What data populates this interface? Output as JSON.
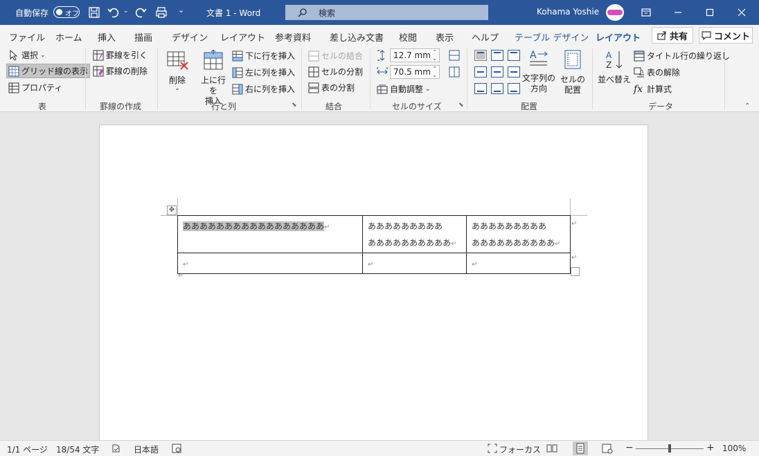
{
  "titlebar": {
    "autosave_label": "自動保存",
    "autosave_state": "オフ",
    "document_title": "文書 1  -  Word",
    "search_placeholder": "検索",
    "user_name": "Kohama Yoshie"
  },
  "tabs": [
    {
      "label": "ファイル"
    },
    {
      "label": "ホーム"
    },
    {
      "label": "挿入"
    },
    {
      "label": "描画"
    },
    {
      "label": "デザイン"
    },
    {
      "label": "レイアウト"
    },
    {
      "label": "参考資料"
    },
    {
      "label": "差し込み文書"
    },
    {
      "label": "校閲"
    },
    {
      "label": "表示"
    },
    {
      "label": "ヘルプ"
    },
    {
      "label": "テーブル デザイン"
    },
    {
      "label": "レイアウト"
    }
  ],
  "share_label": "共有",
  "comment_label": "コメント",
  "ribbon": {
    "table": {
      "select": "選択",
      "gridlines": "グリッド線の表示",
      "properties": "プロパティ",
      "group": "表"
    },
    "draw": {
      "draw_table": "罫線を引く",
      "eraser": "罫線の削除",
      "group": "罫線の作成"
    },
    "rows_cols": {
      "delete": "削除",
      "insert_above_1": "上に行を",
      "insert_above_2": "挿入",
      "insert_below": "下に行を挿入",
      "insert_left": "左に列を挿入",
      "insert_right": "右に列を挿入",
      "group": "行と列"
    },
    "merge": {
      "merge_cells": "セルの結合",
      "split_cells": "セルの分割",
      "split_table": "表の分割",
      "group": "結合"
    },
    "cell_size": {
      "height": "12.7 mm",
      "width": "70.5 mm",
      "autofit": "自動調整",
      "group": "セルのサイズ"
    },
    "alignment": {
      "text_direction_1": "文字列の",
      "text_direction_2": "方向",
      "cell_margins_1": "セルの",
      "cell_margins_2": "配置",
      "group": "配置"
    },
    "data": {
      "sort": "並べ替え",
      "repeat_header": "タイトル行の繰り返し",
      "convert_to_text": "表の解除",
      "formula": "計算式",
      "group": "データ"
    }
  },
  "document": {
    "row1": {
      "cell1": "あああああああああああああああああ",
      "cell2_line1": "あああああああああ",
      "cell2_line2": "ああああああああああ",
      "cell3_line1": "あああああああああ",
      "cell3_line2": "ああああああああああ"
    },
    "para_mark": "↵"
  },
  "status": {
    "page": "1/1 ページ",
    "words": "18/54 文字",
    "language": "日本語",
    "focus": "フォーカス",
    "zoom": "100%"
  },
  "colors": {
    "accent": "#2b579a",
    "search_bg": "#a9bbd7"
  }
}
